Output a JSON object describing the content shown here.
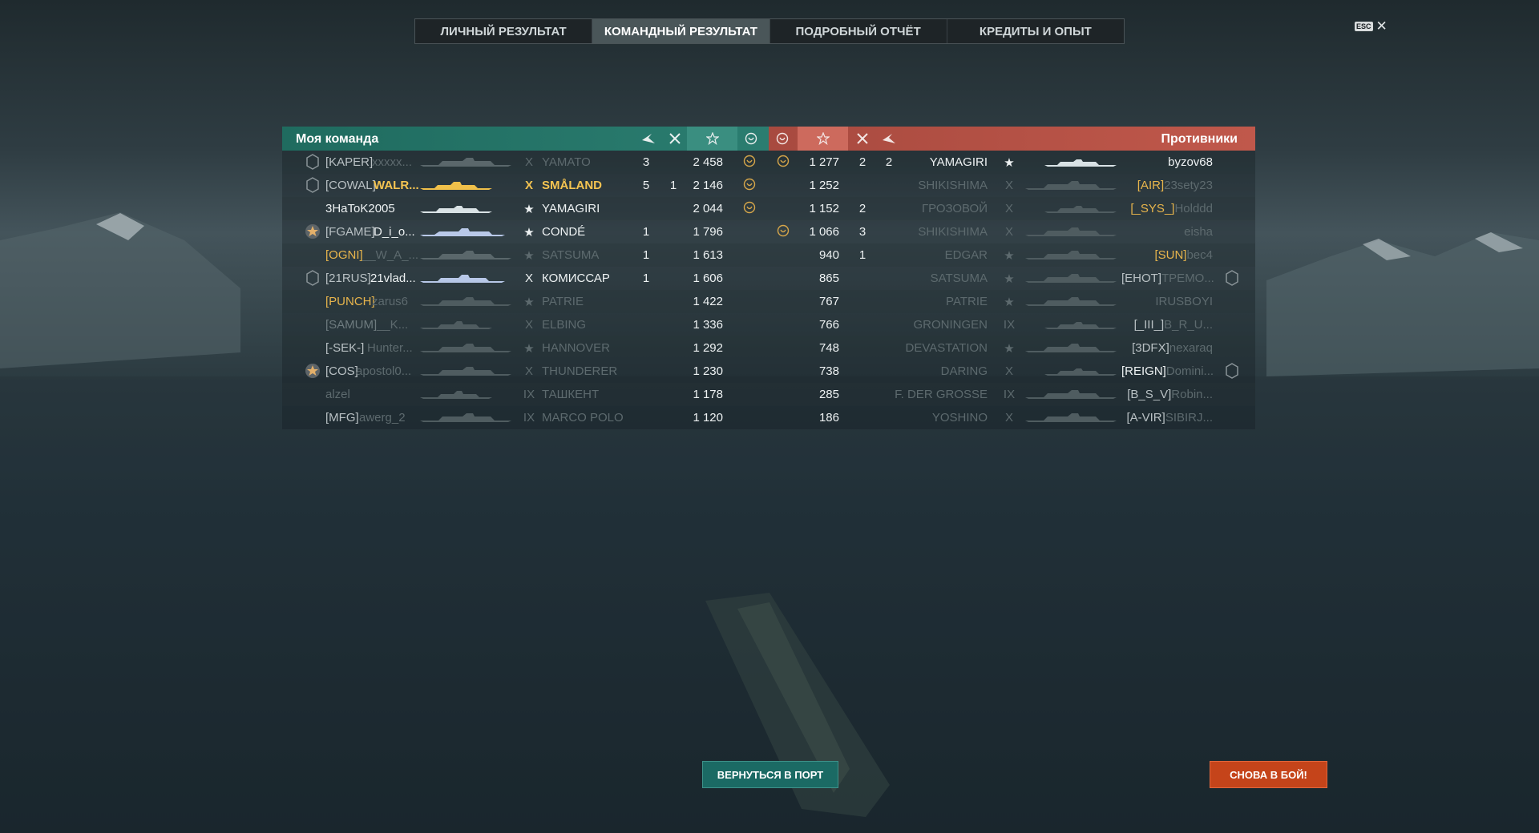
{
  "tabs": [
    {
      "label": "ЛИЧНЫЙ РЕЗУЛЬТАТ",
      "active": false
    },
    {
      "label": "КОМАНДНЫЙ РЕЗУЛЬТАТ",
      "active": true
    },
    {
      "label": "ПОДРОБНЫЙ ОТЧЁТ",
      "active": false
    },
    {
      "label": "КРЕДИТЫ И ОПЫТ",
      "active": false
    }
  ],
  "esc": {
    "key": "ESC",
    "close": "✕"
  },
  "my_team": {
    "title": "Моя команда",
    "color": "#2b7d70",
    "rows": [
      {
        "badge": "5",
        "clan": "[KAPER]",
        "name": "xxxxx...",
        "tier": "X",
        "ship": "YAMATO",
        "a": "3",
        "b": "",
        "score": "2 458",
        "cap": true,
        "style": "dim"
      },
      {
        "badge": "5",
        "clan": "[COWAL]",
        "name": "WALR...",
        "tier": "X",
        "ship": "SMÅLAND",
        "a": "5",
        "b": "1",
        "score": "2 146",
        "cap": true,
        "style": "me"
      },
      {
        "badge": "",
        "clan": "",
        "name": "3HaToK2005",
        "tier": "★",
        "ship": "YAMAGIRI",
        "a": "",
        "b": "",
        "score": "2 044",
        "cap": true,
        "style": "lit"
      },
      {
        "badge": "star",
        "clan": "[FGAME]",
        "name": "D_i_o...",
        "tier": "★",
        "ship": "CONDÉ",
        "a": "1",
        "b": "",
        "score": "1 796",
        "cap": false,
        "style": "lit"
      },
      {
        "badge": "",
        "clan": "[OGNI]",
        "name": "__W_A_...",
        "tier": "★",
        "ship": "SATSUMA",
        "a": "1",
        "b": "",
        "score": "1 613",
        "cap": false,
        "style": "dim",
        "clanGold": true
      },
      {
        "badge": "5",
        "clan": "[21RUS]",
        "name": "21vlad...",
        "tier": "X",
        "ship": "КОМИССАР",
        "a": "1",
        "b": "",
        "score": "1 606",
        "cap": false,
        "style": "lit"
      },
      {
        "badge": "",
        "clan": "[PUNCH]",
        "name": "zarus6",
        "tier": "★",
        "ship": "PATRIE",
        "a": "",
        "b": "",
        "score": "1 422",
        "cap": false,
        "style": "dim",
        "clanGold": true
      },
      {
        "badge": "",
        "clan": "[SAMUM]",
        "name": "__K...",
        "tier": "X",
        "ship": "ELBING",
        "a": "",
        "b": "",
        "score": "1 336",
        "cap": false,
        "style": "dim"
      },
      {
        "badge": "",
        "clan": "[-SEK-]",
        "name": "Hunter...",
        "tier": "★",
        "ship": "HANNOVER",
        "a": "",
        "b": "",
        "score": "1 292",
        "cap": false,
        "style": "dim"
      },
      {
        "badge": "star",
        "clan": "[COS]",
        "name": "apostol0...",
        "tier": "X",
        "ship": "THUNDERER",
        "a": "",
        "b": "",
        "score": "1 230",
        "cap": false,
        "style": "dim"
      },
      {
        "badge": "",
        "clan": "",
        "name": "alzel",
        "tier": "IX",
        "ship": "ТАШКЕНТ",
        "a": "",
        "b": "",
        "score": "1 178",
        "cap": false,
        "style": "dim"
      },
      {
        "badge": "",
        "clan": "[MFG]",
        "name": "awerg_2",
        "tier": "IX",
        "ship": "MARCO POLO",
        "a": "",
        "b": "",
        "score": "1 120",
        "cap": false,
        "style": "dim"
      }
    ]
  },
  "enemies": {
    "title": "Противники",
    "color": "#c0584b",
    "rows": [
      {
        "cap": true,
        "score": "1 277",
        "a": "2",
        "b": "2",
        "ship": "YAMAGIRI",
        "tier": "★",
        "clan": "",
        "name": "byzov68",
        "badge": "",
        "style": "lit"
      },
      {
        "cap": false,
        "score": "1 252",
        "a": "",
        "b": "",
        "ship": "SHIKISHIMA",
        "tier": "X",
        "clan": "[AIR]",
        "name": "23sety23",
        "badge": "",
        "style": "dim",
        "clanGold": true
      },
      {
        "cap": false,
        "score": "1 152",
        "a": "2",
        "b": "",
        "ship": "ГРОЗОВОЙ",
        "tier": "X",
        "clan": "[_SYS_]",
        "name": "Holddd",
        "badge": "",
        "style": "dim",
        "clanGold": true
      },
      {
        "cap": true,
        "score": "1 066",
        "a": "3",
        "b": "",
        "ship": "SHIKISHIMA",
        "tier": "X",
        "clan": "",
        "name": "eisha",
        "badge": "",
        "style": "dim"
      },
      {
        "cap": false,
        "score": "940",
        "a": "1",
        "b": "",
        "ship": "EDGAR",
        "tier": "★",
        "clan": "[SUN]",
        "name": "bec4",
        "badge": "",
        "style": "dim",
        "clanGold": true
      },
      {
        "cap": false,
        "score": "865",
        "a": "",
        "b": "",
        "ship": "SATSUMA",
        "tier": "★",
        "clan": "[EHOT]",
        "name": "TPEMO...",
        "badge": "5",
        "style": "dim"
      },
      {
        "cap": false,
        "score": "767",
        "a": "",
        "b": "",
        "ship": "PATRIE",
        "tier": "★",
        "clan": "",
        "name": "IRUSBOYI",
        "badge": "",
        "style": "dim"
      },
      {
        "cap": false,
        "score": "766",
        "a": "",
        "b": "",
        "ship": "GRONINGEN",
        "tier": "IX",
        "clan": "[_III_]",
        "name": "B_R_U...",
        "badge": "",
        "style": "dim"
      },
      {
        "cap": false,
        "score": "748",
        "a": "",
        "b": "",
        "ship": "DEVASTATION",
        "tier": "★",
        "clan": "[3DFX]",
        "name": "nexaraq",
        "badge": "",
        "style": "dim"
      },
      {
        "cap": false,
        "score": "738",
        "a": "",
        "b": "",
        "ship": "DARING",
        "tier": "X",
        "clan": "[REIGN]",
        "name": "Domini...",
        "badge": "10",
        "style": "dim"
      },
      {
        "cap": false,
        "score": "285",
        "a": "",
        "b": "",
        "ship": "F. DER GROSSE",
        "tier": "IX",
        "clan": "[B_S_V]",
        "name": "Robin...",
        "badge": "",
        "style": "dim"
      },
      {
        "cap": false,
        "score": "186",
        "a": "",
        "b": "",
        "ship": "YOSHINO",
        "tier": "X",
        "clan": "[A-VIR]",
        "name": "SIBIRJ...",
        "badge": "",
        "style": "dim"
      }
    ]
  },
  "buttons": {
    "port": "ВЕРНУТЬСЯ В ПОРТ",
    "battle": "СНОВА В БОЙ!"
  }
}
